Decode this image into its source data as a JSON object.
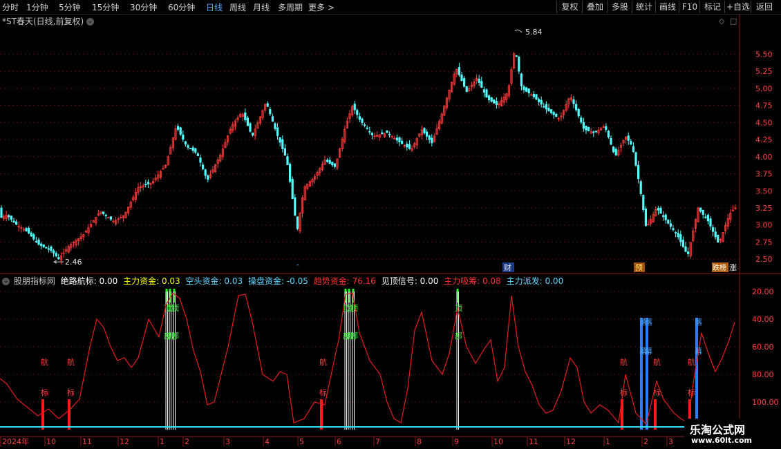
{
  "toolbar": {
    "periods": [
      "分时",
      "1分钟",
      "5分钟",
      "15分钟",
      "30分钟",
      "60分钟",
      "日线",
      "周线",
      "月线",
      "多周期",
      "更多 >"
    ],
    "active_period": "日线",
    "buttons": [
      "复权",
      "叠加",
      "多股",
      "统计",
      "画线",
      "F10",
      "标记",
      "+自选",
      "返回"
    ]
  },
  "stock": {
    "title": "*ST春天(日线,前复权)"
  },
  "price_chart": {
    "y_ticks": [
      "5.50",
      "5.25",
      "5.00",
      "4.75",
      "4.50",
      "4.25",
      "4.00",
      "3.75",
      "3.50",
      "3.25",
      "3.00",
      "2.75",
      "2.50"
    ],
    "high_label": "5.84",
    "low_label": "2.46",
    "markers": [
      "财",
      "预",
      "跌榜",
      "涨"
    ]
  },
  "indicator": {
    "name": "股朋指标网",
    "items": [
      {
        "label": "绝路航标:",
        "value": "0.00",
        "color": "#ffffff"
      },
      {
        "label": "主力资金:",
        "value": "0.03",
        "color": "#ffff00"
      },
      {
        "label": "空头资金:",
        "value": "0.03",
        "color": "#5fd7ff"
      },
      {
        "label": "操盘资金:",
        "value": "-0.05",
        "color": "#5fd7ff"
      },
      {
        "label": "趋势资金:",
        "value": "76.16",
        "color": "#ff3030"
      },
      {
        "label": "见顶信号:",
        "value": "0.00",
        "color": "#ffffff"
      },
      {
        "label": "主力吸筹:",
        "value": "0.08",
        "color": "#ff3030"
      },
      {
        "label": "主力派发:",
        "value": "0.00",
        "color": "#5fd7ff"
      }
    ],
    "y_ticks": [
      "100.00",
      "80.00",
      "60.00",
      "40.00",
      "20.00"
    ],
    "signal_labels": {
      "nav": [
        "航",
        "标"
      ],
      "top": [
        "顶",
        "部"
      ],
      "dist": [
        "落",
        "幕"
      ]
    }
  },
  "x_axis": [
    "2024年",
    "10",
    "11",
    "12",
    "1",
    "2",
    "3",
    "4",
    "5",
    "6",
    "7",
    "8",
    "9",
    "10",
    "11",
    "12",
    "1",
    "2",
    "3"
  ],
  "watermark": {
    "name": "乐淘公式网",
    "url": "www.60lt.com"
  },
  "chart_data": [
    {
      "type": "candlestick",
      "title": "*ST春天(日线,前复权)",
      "ylim": [
        2.35,
        5.95
      ],
      "y_ticks": [
        2.5,
        2.75,
        3.0,
        3.25,
        3.5,
        3.75,
        4.0,
        4.25,
        4.5,
        4.75,
        5.0,
        5.25,
        5.5
      ],
      "annotations": [
        {
          "text": "5.84",
          "value": 5.84
        },
        {
          "text": "2.46",
          "value": 2.46
        }
      ],
      "close_path": [
        [
          0,
          3.1
        ],
        [
          10,
          3.15
        ],
        [
          22,
          3.02
        ],
        [
          40,
          2.9
        ],
        [
          55,
          2.72
        ],
        [
          75,
          2.62
        ],
        [
          85,
          2.5
        ],
        [
          100,
          2.7
        ],
        [
          120,
          2.85
        ],
        [
          145,
          3.2
        ],
        [
          165,
          3.05
        ],
        [
          180,
          3.15
        ],
        [
          200,
          3.55
        ],
        [
          220,
          3.62
        ],
        [
          240,
          3.88
        ],
        [
          255,
          4.45
        ],
        [
          270,
          4.15
        ],
        [
          285,
          4.05
        ],
        [
          300,
          3.65
        ],
        [
          320,
          4.05
        ],
        [
          335,
          4.45
        ],
        [
          350,
          4.65
        ],
        [
          365,
          4.3
        ],
        [
          385,
          4.8
        ],
        [
          400,
          4.35
        ],
        [
          415,
          3.95
        ],
        [
          430,
          2.92
        ],
        [
          440,
          3.55
        ],
        [
          455,
          3.7
        ],
        [
          470,
          3.95
        ],
        [
          485,
          3.85
        ],
        [
          500,
          4.45
        ],
        [
          510,
          4.75
        ],
        [
          520,
          4.55
        ],
        [
          540,
          4.3
        ],
        [
          560,
          4.35
        ],
        [
          580,
          4.2
        ],
        [
          595,
          4.1
        ],
        [
          610,
          4.4
        ],
        [
          625,
          4.2
        ],
        [
          640,
          4.65
        ],
        [
          660,
          5.3
        ],
        [
          675,
          4.95
        ],
        [
          690,
          5.15
        ],
        [
          705,
          4.85
        ],
        [
          720,
          4.75
        ],
        [
          735,
          4.95
        ],
        [
          745,
          5.6
        ],
        [
          755,
          5.0
        ],
        [
          770,
          4.9
        ],
        [
          790,
          4.7
        ],
        [
          810,
          4.55
        ],
        [
          825,
          4.9
        ],
        [
          845,
          4.4
        ],
        [
          860,
          4.35
        ],
        [
          875,
          4.45
        ],
        [
          890,
          4.0
        ],
        [
          905,
          4.3
        ],
        [
          915,
          4.15
        ],
        [
          925,
          3.6
        ],
        [
          935,
          2.95
        ],
        [
          950,
          3.25
        ],
        [
          965,
          3.05
        ],
        [
          980,
          2.85
        ],
        [
          995,
          2.55
        ],
        [
          1010,
          3.25
        ],
        [
          1025,
          3.05
        ],
        [
          1040,
          2.72
        ],
        [
          1055,
          3.15
        ],
        [
          1063,
          3.25
        ]
      ]
    },
    {
      "type": "line",
      "name": "趋势资金",
      "ylim": [
        0,
        105
      ],
      "y_ticks": [
        20,
        40,
        60,
        80,
        100
      ],
      "points": [
        [
          0,
          37
        ],
        [
          10,
          33
        ],
        [
          25,
          22
        ],
        [
          40,
          16
        ],
        [
          55,
          10
        ],
        [
          70,
          15
        ],
        [
          85,
          8
        ],
        [
          100,
          14
        ],
        [
          115,
          22
        ],
        [
          130,
          60
        ],
        [
          140,
          80
        ],
        [
          150,
          74
        ],
        [
          160,
          60
        ],
        [
          170,
          50
        ],
        [
          180,
          52
        ],
        [
          190,
          45
        ],
        [
          200,
          52
        ],
        [
          215,
          80
        ],
        [
          230,
          67
        ],
        [
          240,
          90
        ],
        [
          250,
          99
        ],
        [
          260,
          95
        ],
        [
          270,
          80
        ],
        [
          280,
          57
        ],
        [
          290,
          42
        ],
        [
          300,
          18
        ],
        [
          310,
          20
        ],
        [
          320,
          40
        ],
        [
          330,
          60
        ],
        [
          345,
          97
        ],
        [
          355,
          98
        ],
        [
          365,
          78
        ],
        [
          380,
          40
        ],
        [
          395,
          35
        ],
        [
          405,
          42
        ],
        [
          415,
          40
        ],
        [
          425,
          5
        ],
        [
          440,
          8
        ],
        [
          455,
          20
        ],
        [
          470,
          18
        ],
        [
          480,
          42
        ],
        [
          490,
          65
        ],
        [
          500,
          98
        ],
        [
          510,
          99
        ],
        [
          520,
          70
        ],
        [
          535,
          50
        ],
        [
          550,
          40
        ],
        [
          560,
          20
        ],
        [
          570,
          8
        ],
        [
          580,
          5
        ],
        [
          590,
          30
        ],
        [
          600,
          72
        ],
        [
          610,
          85
        ],
        [
          625,
          50
        ],
        [
          640,
          40
        ],
        [
          650,
          55
        ],
        [
          662,
          88
        ],
        [
          675,
          60
        ],
        [
          688,
          48
        ],
        [
          700,
          58
        ],
        [
          710,
          65
        ],
        [
          720,
          35
        ],
        [
          730,
          45
        ],
        [
          740,
          97
        ],
        [
          750,
          60
        ],
        [
          760,
          42
        ],
        [
          770,
          32
        ],
        [
          780,
          18
        ],
        [
          790,
          12
        ],
        [
          800,
          14
        ],
        [
          812,
          28
        ],
        [
          825,
          52
        ],
        [
          835,
          45
        ],
        [
          845,
          20
        ],
        [
          855,
          12
        ],
        [
          868,
          18
        ],
        [
          880,
          14
        ],
        [
          895,
          5
        ],
        [
          905,
          40
        ],
        [
          920,
          12
        ],
        [
          935,
          4
        ],
        [
          950,
          35
        ],
        [
          960,
          22
        ],
        [
          975,
          12
        ],
        [
          985,
          8
        ],
        [
          995,
          5
        ],
        [
          1005,
          40
        ],
        [
          1015,
          70
        ],
        [
          1025,
          55
        ],
        [
          1035,
          42
        ],
        [
          1045,
          52
        ],
        [
          1055,
          65
        ],
        [
          1063,
          78
        ]
      ]
    },
    {
      "type": "line",
      "name": "主力吸筹",
      "points": [
        [
          0,
          2
        ],
        [
          1063,
          2
        ]
      ]
    }
  ]
}
